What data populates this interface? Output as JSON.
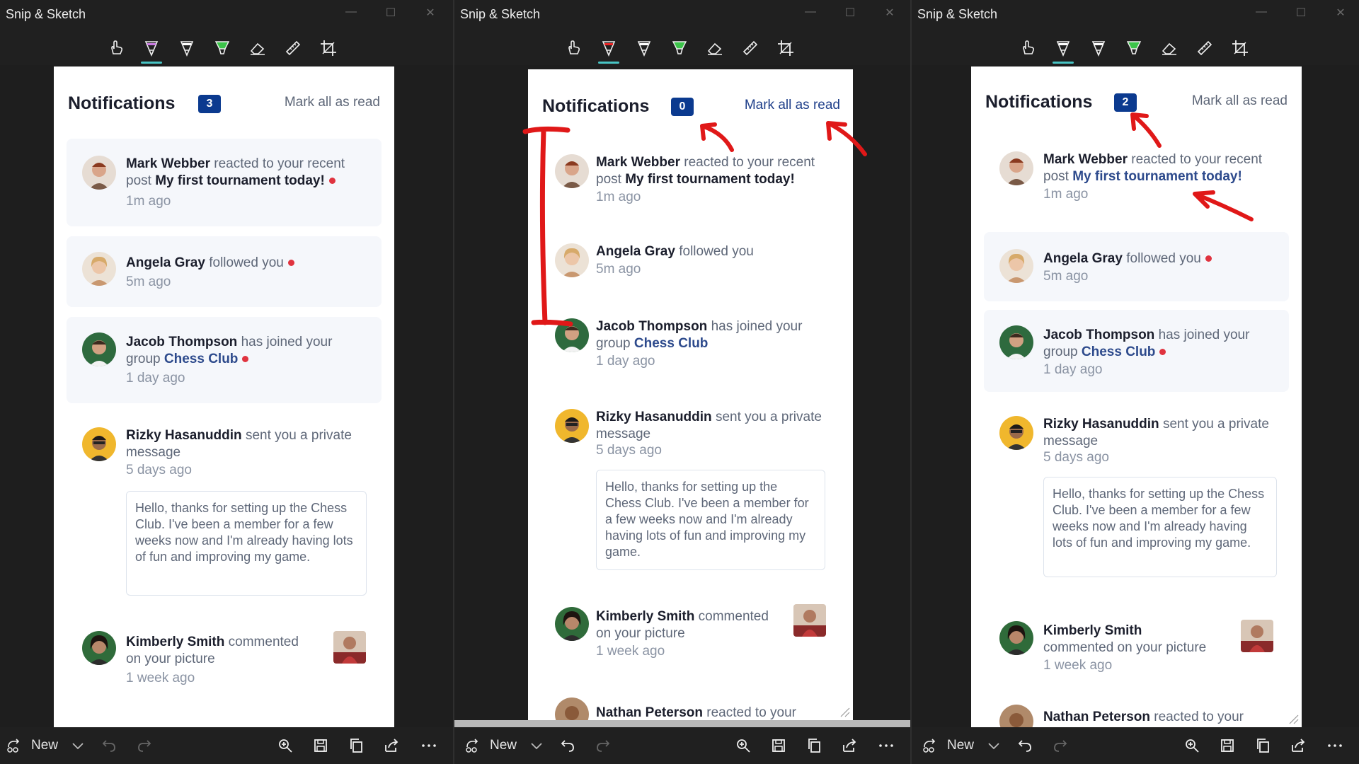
{
  "windows": [
    {
      "title": "Snip & Sketch",
      "unread_count": "3",
      "mark_all": "Mark all as read"
    },
    {
      "title": "Snip & Sketch",
      "unread_count": "0",
      "mark_all": "Mark all as read"
    },
    {
      "title": "Snip & Sketch",
      "unread_count": "2",
      "mark_all": "Mark all as read"
    }
  ],
  "notifications_title": "Notifications",
  "notifications": {
    "mark": {
      "name": "Mark Webber",
      "action": "reacted to your recent post",
      "target": "My first tournament today!",
      "time": "1m ago"
    },
    "angela": {
      "name": "Angela Gray",
      "action": "followed you",
      "time": "5m ago"
    },
    "jacob": {
      "name": "Jacob Thompson",
      "action": "has joined your group",
      "target": "Chess Club",
      "time": "1 day ago"
    },
    "rizky": {
      "name": "Rizky Hasanuddin",
      "action": "sent you a private message",
      "time": "5 days ago",
      "message": "Hello, thanks for setting up the Chess Club. I've been a member for a few weeks now and I'm already having lots of fun and improving my game."
    },
    "kimberly": {
      "name": "Kimberly Smith",
      "action": "commented on your picture",
      "time": "1 week ago"
    },
    "nathan": {
      "name": "Nathan Peterson",
      "action": "reacted to your"
    }
  },
  "bottom_bar": {
    "new_label": "New"
  },
  "icons": {
    "toolbar": [
      "touch-writing-icon",
      "ballpoint-pen-icon",
      "pencil-icon",
      "highlighter-icon",
      "eraser-icon",
      "ruler-icon",
      "crop-icon"
    ],
    "bottom": [
      "new-snip-icon",
      "chevron-down-icon",
      "undo-icon",
      "redo-icon",
      "zoom-icon",
      "save-icon",
      "copy-icon",
      "share-icon",
      "more-icon"
    ]
  },
  "colors": {
    "badge": "#0b3a8f",
    "unread_dot": "#e0333f",
    "link_blue": "#2d4a8c",
    "annotation_red": "#e01818",
    "active_tool_underline": "#48c4c4"
  }
}
